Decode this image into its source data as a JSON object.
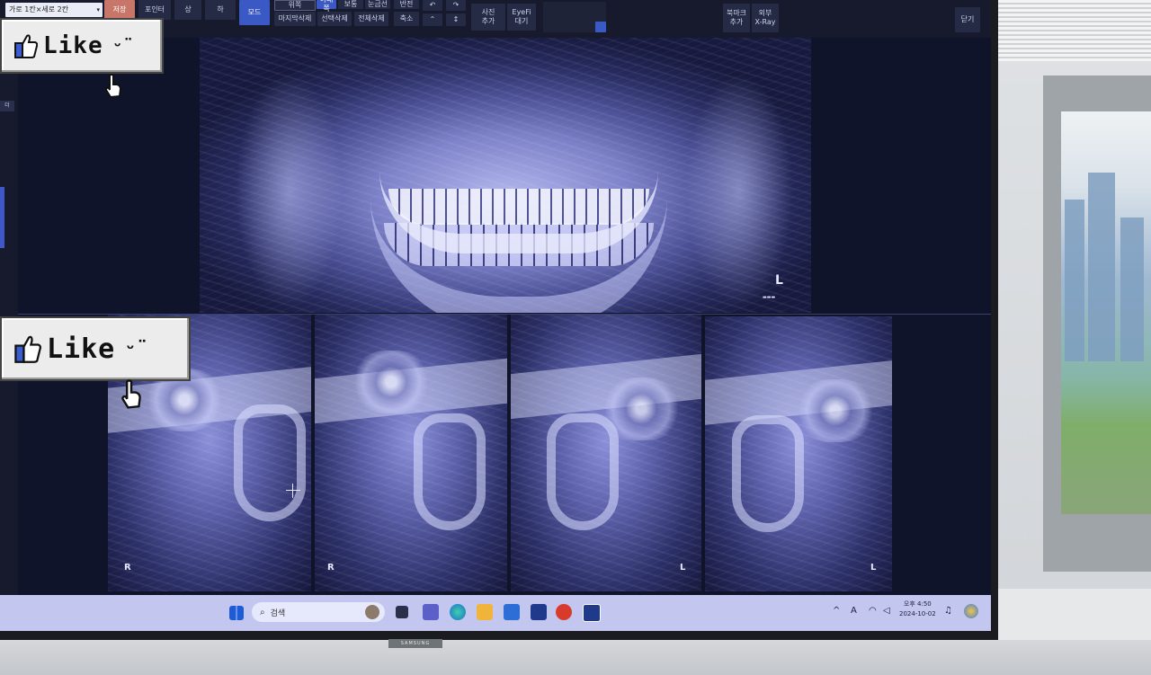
{
  "toolbar": {
    "layout_select": "가로 1칸×세로 2칸",
    "b_save": "저장",
    "b_point": "포인터",
    "b_up": "상",
    "b_down": "하",
    "b_down_label": "하",
    "b_mode": "모드",
    "b_dark": "밝기",
    "b_upper": "위쪽",
    "b_lower": "아래쪽",
    "b_single": "보통",
    "b_reverse": "반전",
    "b_normal": "원본",
    "b_line": "회전",
    "b_ruler": "눈금선",
    "b_last_delete": "마지막삭제",
    "b_select_delete": "선택삭제",
    "b_all_delete": "전체삭제",
    "b_zoom_in": "확대",
    "b_zoom_out": "축소",
    "b_photo_add": "사진\n추가",
    "b_eyefi": "EyeFi\n대기",
    "b_bookmark": "북마크\n추가",
    "b_xray": "외부\nX-Ray",
    "b_close": "닫기"
  },
  "left": {
    "tab": "더"
  },
  "stickers": [
    {
      "label": "Like",
      "smile": "ᵕ̈"
    },
    {
      "label": "Like",
      "smile": "ᵕ̈"
    }
  ],
  "panels": {
    "pano_side": "L",
    "tmj_sides": [
      "R",
      "R",
      "L",
      "L"
    ]
  },
  "taskbar": {
    "search_placeholder": "검색",
    "clock_time": "오후 4:50",
    "clock_date": "2024-10-02"
  },
  "tv_brand": "SAMSUNG"
}
